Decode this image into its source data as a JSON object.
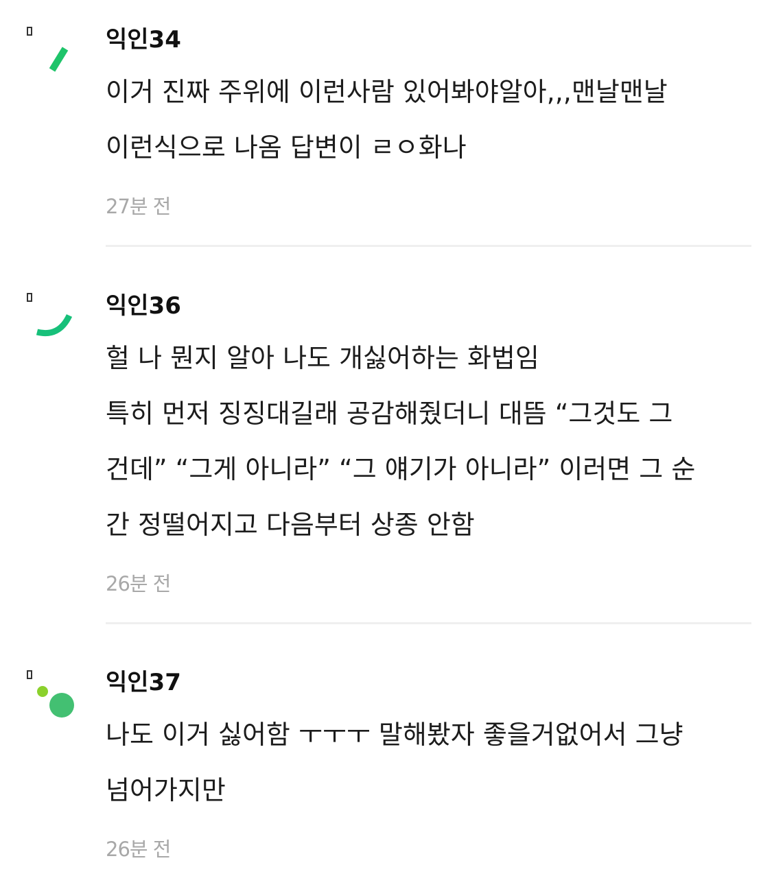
{
  "comments": [
    {
      "author": "익인34",
      "lines": [
        "이거 진짜 주위에 이런사람 있어봐야알아,,,맨날맨날",
        "이런식으로 나옴 답변이 ㄹㅇ화나"
      ],
      "time": "27분 전"
    },
    {
      "author": "익인36",
      "lines": [
        "헐 나 뭔지 알아 나도 개싫어하는 화법임",
        "특히 먼저 징징대길래 공감해줬더니 대뜸 “그것도 그",
        "건데” “그게 아니라” “그 얘기가 아니라” 이러면 그 순",
        "간 정떨어지고 다음부터 상종 안함"
      ],
      "time": "26분 전"
    },
    {
      "author": "익인37",
      "lines": [
        "나도 이거 싫어함 ㅜㅜㅜ 말해봤자 좋을거없어서 그냥",
        "넘어가지만"
      ],
      "time": "26분 전"
    }
  ],
  "avatar_colors": {
    "green_stroke": "#1ec46a",
    "teal_arc": "#17c07a",
    "lime_dot": "#8bd12c",
    "green_dot": "#43c072",
    "badge": "#333333"
  },
  "avatar_icons": [
    "slash-icon",
    "arc-icon",
    "dots-icon"
  ]
}
